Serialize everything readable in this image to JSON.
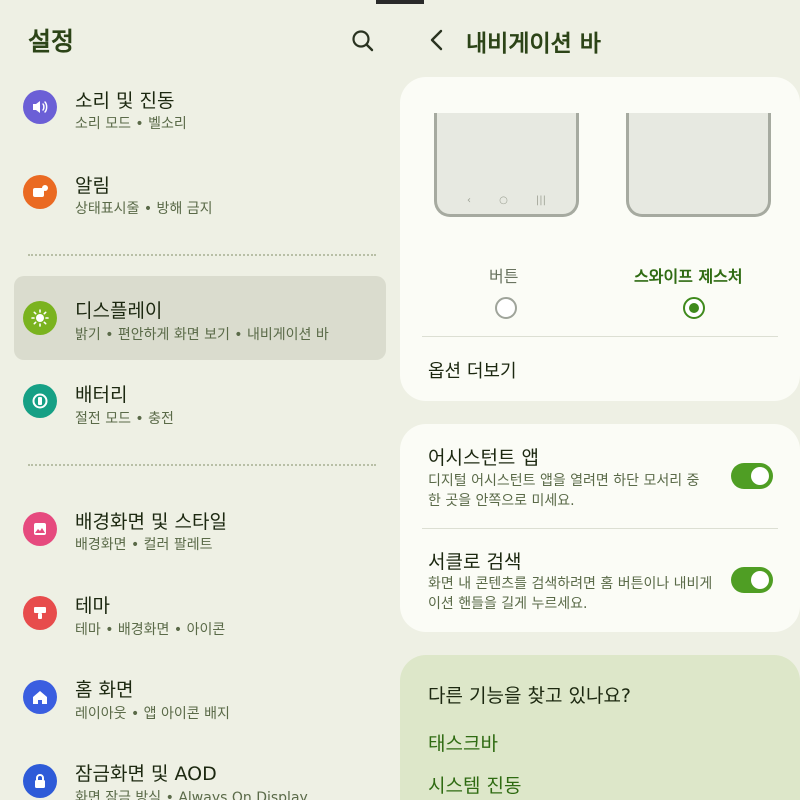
{
  "left": {
    "title": "설정",
    "search_icon": "search-icon",
    "items": [
      {
        "title": "소리 및 진동",
        "subtitle": "소리 모드  •  벨소리",
        "icon": "volume-icon",
        "color": "#6b5fd6"
      },
      {
        "title": "알림",
        "subtitle": "상태표시줄  •  방해 금지",
        "icon": "notification-icon",
        "color": "#ea6a22"
      },
      {
        "title": "디스플레이",
        "subtitle": "밝기  •  편안하게 화면 보기  •  내비게이션 바",
        "icon": "brightness-icon",
        "color": "#7ab31f"
      },
      {
        "title": "배터리",
        "subtitle": "절전 모드  •  충전",
        "icon": "battery-icon",
        "color": "#16a085"
      },
      {
        "title": "배경화면 및 스타일",
        "subtitle": "배경화면  •  컬러 팔레트",
        "icon": "wallpaper-icon",
        "color": "#e64a7e"
      },
      {
        "title": "테마",
        "subtitle": "테마  •  배경화면  •  아이콘",
        "icon": "theme-icon",
        "color": "#e74c4c"
      },
      {
        "title": "홈 화면",
        "subtitle": "레이아웃  •  앱 아이콘 배지",
        "icon": "home-icon",
        "color": "#3a5ee0"
      },
      {
        "title": "잠금화면 및 AOD",
        "subtitle": "화면 잠금 방식  •  Always On Display",
        "icon": "lock-icon",
        "color": "#2e5bd8"
      }
    ]
  },
  "right": {
    "title": "내비게이션 바",
    "back_icon": "back-arrow-icon",
    "nav_type": {
      "options": [
        {
          "label": "버튼",
          "selected": false
        },
        {
          "label": "스와이프 제스처",
          "selected": true
        }
      ],
      "button_nav_glyphs": [
        "‹",
        "○",
        "|||"
      ]
    },
    "more_options": "옵션 더보기",
    "assistant": {
      "title": "어시스턴트 앱",
      "desc": "디지털 어시스턴트 앱을 열려면 하단 모서리 중 한 곳을 안쪽으로 미세요.",
      "on": true
    },
    "circle_search": {
      "title": "서클로 검색",
      "desc": "화면 내 콘텐츠를 검색하려면 홈 버튼이나 내비게이션 핸들을 길게 누르세요.",
      "on": true
    },
    "suggestions": {
      "title": "다른 기능을 찾고 있나요?",
      "links": [
        "태스크바",
        "시스템 진동"
      ]
    }
  },
  "colors": {
    "background": "#eef0e4",
    "accent": "#3f8a1c",
    "selected_bg": "#dadcce",
    "link": "#2f6b12"
  }
}
